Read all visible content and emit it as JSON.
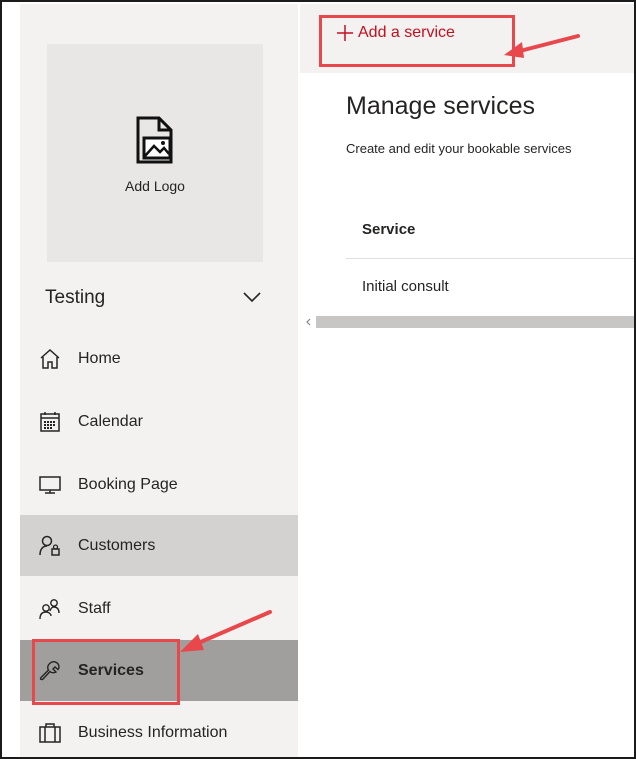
{
  "sidebar": {
    "logo_label": "Add Logo",
    "business_name": "Testing",
    "items": [
      {
        "label": "Home",
        "icon": "home-icon"
      },
      {
        "label": "Calendar",
        "icon": "calendar-icon"
      },
      {
        "label": "Booking Page",
        "icon": "monitor-icon"
      },
      {
        "label": "Customers",
        "icon": "customers-icon"
      },
      {
        "label": "Staff",
        "icon": "staff-icon"
      },
      {
        "label": "Services",
        "icon": "wrench-icon"
      },
      {
        "label": "Business Information",
        "icon": "briefcase-icon"
      }
    ]
  },
  "toolbar": {
    "add_service_label": "Add a service"
  },
  "main": {
    "title": "Manage services",
    "subtitle": "Create and edit your bookable services",
    "table": {
      "header": "Service",
      "rows": [
        "Initial consult"
      ]
    }
  },
  "colors": {
    "accent_red": "#c50f1f",
    "highlight": "#e8474b",
    "sidebar_bg": "#f3f2f1",
    "active_dark": "#a19f9d",
    "active_light": "#d3d2d1"
  }
}
